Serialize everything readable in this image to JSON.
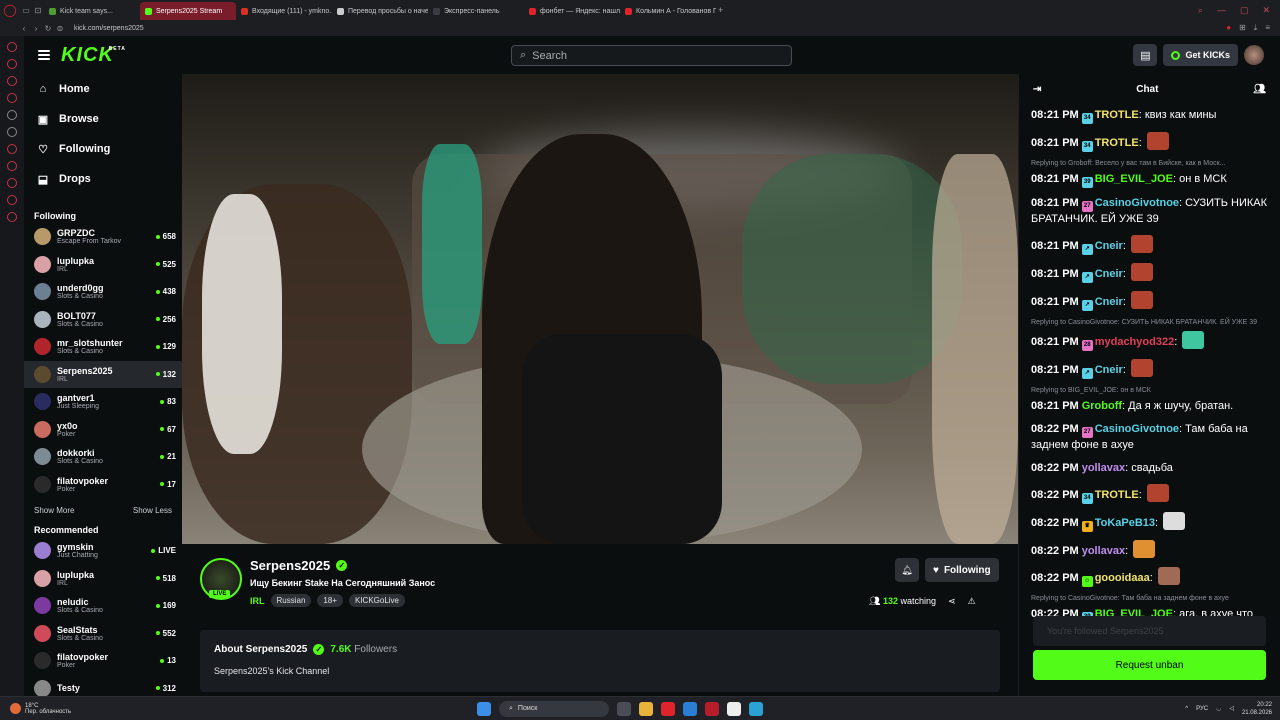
{
  "browser": {
    "tabs": [
      {
        "label": "Kick team says...",
        "color": "#4d9c34",
        "active": false
      },
      {
        "label": "Serpens2025 Stream",
        "color": "#53fc18",
        "active": true
      },
      {
        "label": "Входящие (111) - ymkno...",
        "color": "#d93025",
        "active": false
      },
      {
        "label": "Перевод просьбы о наче...",
        "color": "#cccccc",
        "active": false
      },
      {
        "label": "Экспресс-панель",
        "color": "#3a3d44",
        "active": false
      },
      {
        "label": "фонбет — Яндекс: нашло...",
        "color": "#e0242c",
        "active": false
      },
      {
        "label": "Кольмин А - Голованов Г",
        "color": "#e0242c",
        "active": false
      }
    ],
    "url": "kick.com/serpens2025"
  },
  "header": {
    "logo": "KICK",
    "logo_beta": "BETA",
    "search_placeholder": "Search",
    "kicks_label": "Get KICKs"
  },
  "sidebar": {
    "nav": [
      {
        "label": "Home",
        "icon": "⌂"
      },
      {
        "label": "Browse",
        "icon": "▣"
      },
      {
        "label": "Following",
        "icon": "♡"
      },
      {
        "label": "Drops",
        "icon": "⬓"
      }
    ],
    "following_title": "Following",
    "following": [
      {
        "name": "GRPZDC",
        "cat": "Escape From Tarkov",
        "viewers": "658",
        "color": "#b89a6a"
      },
      {
        "name": "luplupka",
        "cat": "IRL",
        "viewers": "525",
        "color": "#d9a0a6"
      },
      {
        "name": "underd0gg",
        "cat": "Slots & Casino",
        "viewers": "438",
        "color": "#6d7f93"
      },
      {
        "name": "BOLT077",
        "cat": "Slots & Casino",
        "viewers": "256",
        "color": "#a9b4bd"
      },
      {
        "name": "mr_slotshunter",
        "cat": "Slots & Casino",
        "viewers": "129",
        "color": "#b0242c"
      },
      {
        "name": "Serpens2025",
        "cat": "IRL",
        "viewers": "132",
        "color": "#5a4a2e"
      },
      {
        "name": "gantver1",
        "cat": "Just Sleeping",
        "viewers": "83",
        "color": "#2a2c60"
      },
      {
        "name": "yx0o",
        "cat": "Poker",
        "viewers": "67",
        "color": "#c96b5e"
      },
      {
        "name": "dokkorki",
        "cat": "Slots & Casino",
        "viewers": "21",
        "color": "#7c8a94"
      },
      {
        "name": "filatovpoker",
        "cat": "Poker",
        "viewers": "17",
        "color": "#2a2a2a"
      }
    ],
    "show_more": "Show More",
    "show_less": "Show Less",
    "recommended_title": "Recommended",
    "recommended": [
      {
        "name": "gymskin",
        "cat": "Just Chatting",
        "viewers": "LIVE",
        "color": "#9a7fd0"
      },
      {
        "name": "luplupka",
        "cat": "IRL",
        "viewers": "518",
        "color": "#d9a0a6"
      },
      {
        "name": "neludic",
        "cat": "Slots & Casino",
        "viewers": "169",
        "color": "#7a3aa0"
      },
      {
        "name": "SealStats",
        "cat": "Slots & Casino",
        "viewers": "552",
        "color": "#d04a5a"
      },
      {
        "name": "filatovpoker",
        "cat": "Poker",
        "viewers": "13",
        "color": "#2a2a2a"
      },
      {
        "name": "Testy",
        "cat": "",
        "viewers": "312",
        "color": "#888888"
      }
    ]
  },
  "stream": {
    "name": "Serpens2025",
    "live": "LIVE",
    "title": "Ищу Бекинг Stake На Сегодняшний Занос",
    "category": "IRL",
    "tags": [
      "Russian",
      "18+",
      "KICKGoLive"
    ],
    "follow_label": "Following",
    "viewers": "132",
    "viewers_label": "watching",
    "about_title": "About Serpens2025",
    "followers": "7.6K",
    "followers_label": "Followers",
    "about_desc": "Serpens2025's Kick Channel"
  },
  "chat": {
    "title": "Chat",
    "messages": [
      {
        "time": "08:21 PM",
        "badge": "34",
        "badge_color": "#5ad1e6",
        "user": "TROTLE",
        "user_color": "#f3e36d",
        "text": "квиз как мины"
      },
      {
        "time": "08:21 PM",
        "badge": "34",
        "badge_color": "#5ad1e6",
        "user": "TROTLE",
        "user_color": "#f3e36d",
        "text": "",
        "emote": "#b2432f"
      },
      {
        "reply": "Replying to Groboff: Весело у вас там в Бийске, как в Моск..."
      },
      {
        "time": "08:21 PM",
        "badge": "39",
        "badge_color": "#5ad1e6",
        "user": "BIG_EVIL_JOE",
        "user_color": "#53fc18",
        "text": "он в МСК"
      },
      {
        "time": "08:21 PM",
        "badge": "27",
        "badge_color": "#e673c6",
        "user": "CasinoGivotnoe",
        "user_color": "#5ad1e6",
        "text": "СУЗИТЬ НИКАК БРАТАНЧИК. ЕЙ УЖЕ 39"
      },
      {
        "time": "08:21 PM",
        "badge": "↗",
        "badge_color": "#5ad1e6",
        "user": "Cneir",
        "user_color": "#5ad1e6",
        "text": "",
        "emote": "#b2432f"
      },
      {
        "time": "08:21 PM",
        "badge": "↗",
        "badge_color": "#5ad1e6",
        "user": "Cneir",
        "user_color": "#5ad1e6",
        "text": "",
        "emote": "#b2432f"
      },
      {
        "time": "08:21 PM",
        "badge": "↗",
        "badge_color": "#5ad1e6",
        "user": "Cneir",
        "user_color": "#5ad1e6",
        "text": "",
        "emote": "#b2432f"
      },
      {
        "reply": "Replying to CasinoGivotnoe: СУЗИТЬ НИКАК БРАТАНЧИК. ЕЙ УЖЕ 39"
      },
      {
        "time": "08:21 PM",
        "badge": "28",
        "badge_color": "#e673c6",
        "user": "mydachyod322",
        "user_color": "#e0405a",
        "text": "",
        "emote": "#3fc7a0"
      },
      {
        "time": "08:21 PM",
        "badge": "↗",
        "badge_color": "#5ad1e6",
        "user": "Cneir",
        "user_color": "#5ad1e6",
        "text": "",
        "emote": "#b2432f"
      },
      {
        "reply": "Replying to BIG_EVIL_JOE: он в МСК"
      },
      {
        "time": "08:21 PM",
        "badge": "",
        "badge_color": "",
        "user": "Groboff",
        "user_color": "#53fc18",
        "text": "Да я ж шучу, братан."
      },
      {
        "time": "08:22 PM",
        "badge": "27",
        "badge_color": "#e673c6",
        "user": "CasinoGivotnoe",
        "user_color": "#5ad1e6",
        "text": "Там баба на заднем фоне в ахуе"
      },
      {
        "time": "08:22 PM",
        "badge": "",
        "badge_color": "",
        "user": "yollavax",
        "user_color": "#c08ef0",
        "text": "свадьба"
      },
      {
        "time": "08:22 PM",
        "badge": "34",
        "badge_color": "#5ad1e6",
        "user": "TROTLE",
        "user_color": "#f3e36d",
        "text": "",
        "emote": "#b2432f"
      },
      {
        "time": "08:22 PM",
        "badge": "♛",
        "badge_color": "#f0b020",
        "user": "ToKaPeB13",
        "user_color": "#5ad1e6",
        "text": "",
        "emote": "#dddddd"
      },
      {
        "time": "08:22 PM",
        "badge": "",
        "badge_color": "",
        "user": "yollavax",
        "user_color": "#c08ef0",
        "text": "",
        "emote": "#e09030"
      },
      {
        "time": "08:22 PM",
        "badge": "☺",
        "badge_color": "#53fc18",
        "user": "goooidaaa",
        "user_color": "#f3e36d",
        "text": "",
        "emote": "#a06a55"
      },
      {
        "reply": "Replying to CasinoGivotnoe: Там баба на заднем фоне в ахуе"
      },
      {
        "time": "08:22 PM",
        "badge": "39",
        "badge_color": "#5ad1e6",
        "user": "BIG_EVIL_JOE",
        "user_color": "#53fc18",
        "text": "ага, в ахуе что рядом со звездой сидит"
      }
    ],
    "input_placeholder": "You're followed Serpens2025",
    "unban_label": "Request unban"
  },
  "taskbar": {
    "temp": "18°C",
    "weather": "Пер. облачность",
    "search": "Поиск",
    "lang": "РУС",
    "time": "20:22",
    "date": "21.08.2026"
  }
}
